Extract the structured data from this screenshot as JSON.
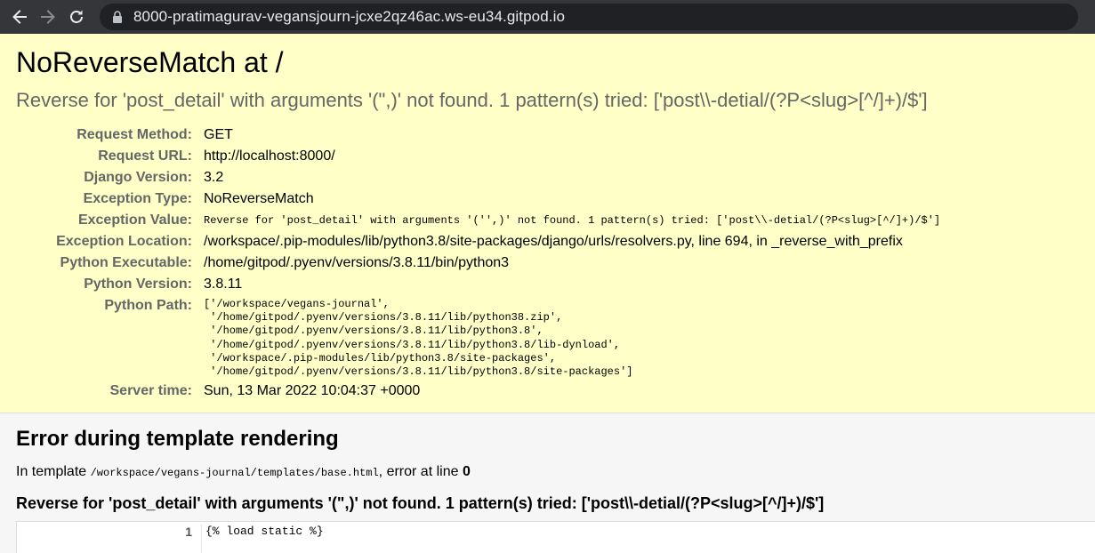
{
  "browser": {
    "url": "8000-pratimagurav-vegansjourn-jcxe2qz46ac.ws-eu34.gitpod.io",
    "icons": [
      "back-arrow-icon",
      "forward-arrow-icon",
      "reload-icon",
      "lock-icon"
    ],
    "colors": {
      "toolbar": "#35363a",
      "omnibox": "#202124"
    }
  },
  "summary": {
    "title": "NoReverseMatch at /",
    "exception_value": "Reverse for 'post_detail' with arguments '(\",)' not found. 1 pattern(s) tried: ['post\\\\-detial/(?P<slug>[^/]+)/$']",
    "meta": {
      "request_method": {
        "label": "Request Method:",
        "value": "GET"
      },
      "request_url": {
        "label": "Request URL:",
        "value": "http://localhost:8000/"
      },
      "django_version": {
        "label": "Django Version:",
        "value": "3.2"
      },
      "exception_type": {
        "label": "Exception Type:",
        "value": "NoReverseMatch"
      },
      "exception_value": {
        "label": "Exception Value:",
        "value": "Reverse for 'post_detail' with arguments '('',)' not found. 1 pattern(s) tried: ['post\\\\-detial/(?P<slug>[^/]+)/$']"
      },
      "exception_location": {
        "label": "Exception Location:",
        "value": "/workspace/.pip-modules/lib/python3.8/site-packages/django/urls/resolvers.py, line 694, in _reverse_with_prefix"
      },
      "python_executable": {
        "label": "Python Executable:",
        "value": "/home/gitpod/.pyenv/versions/3.8.11/bin/python3"
      },
      "python_version": {
        "label": "Python Version:",
        "value": "3.8.11"
      },
      "python_path": {
        "label": "Python Path:",
        "value": "['/workspace/vegans-journal',\n '/home/gitpod/.pyenv/versions/3.8.11/lib/python38.zip',\n '/home/gitpod/.pyenv/versions/3.8.11/lib/python3.8',\n '/home/gitpod/.pyenv/versions/3.8.11/lib/python3.8/lib-dynload',\n '/workspace/.pip-modules/lib/python3.8/site-packages',\n '/home/gitpod/.pyenv/versions/3.8.11/lib/python3.8/site-packages']"
      },
      "server_time": {
        "label": "Server time:",
        "value": "Sun, 13 Mar 2022 10:04:37 +0000"
      }
    },
    "colors": {
      "background": "#ffffc8",
      "label": "#666666"
    }
  },
  "template": {
    "heading": "Error during template rendering",
    "info_prefix": "In template",
    "info_path": "/workspace/vegans-journal/templates/base.html",
    "info_middle": ", error at line",
    "info_line": "0",
    "error_message": "Reverse for 'post_detail' with arguments '(\",)' not found. 1 pattern(s) tried: ['post\\\\-detial/(?P<slug>[^/]+)/$']",
    "source": [
      {
        "line": "1",
        "code": "{% load static %}"
      }
    ]
  }
}
